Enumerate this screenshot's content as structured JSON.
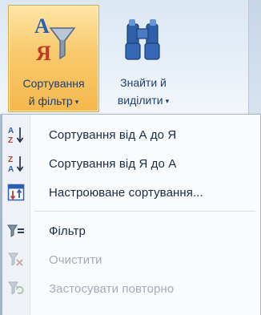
{
  "ribbon": {
    "sort_filter": {
      "label_line1": "Сортування",
      "label_line2": "й фільтр",
      "caret": "▾",
      "icon": "sort-az-funnel-icon",
      "state": "pressed"
    },
    "find_select": {
      "label_line1": "Знайти й",
      "label_line2": "виділити",
      "caret": "▾",
      "icon": "binoculars-icon"
    }
  },
  "menu": {
    "items": [
      {
        "label": "Сортування від А до Я",
        "icon": "sort-a-to-z-icon",
        "enabled": true
      },
      {
        "label": "Сортування від Я до А",
        "icon": "sort-z-to-a-icon",
        "enabled": true
      },
      {
        "label": "Настроюване сортування...",
        "icon": "custom-sort-icon",
        "enabled": true
      },
      {
        "label": "Фільтр",
        "icon": "filter-icon",
        "enabled": true
      },
      {
        "label": "Очистити",
        "icon": "clear-filter-icon",
        "enabled": false
      },
      {
        "label": "Застосувати повторно",
        "icon": "reapply-filter-icon",
        "enabled": false
      }
    ]
  },
  "colors": {
    "accent_pressed": "#f8c96b",
    "text": "#1b2a44",
    "text_disabled": "#a3acb8",
    "sort_blue": "#2b5fb4",
    "sort_red": "#c0392b"
  }
}
